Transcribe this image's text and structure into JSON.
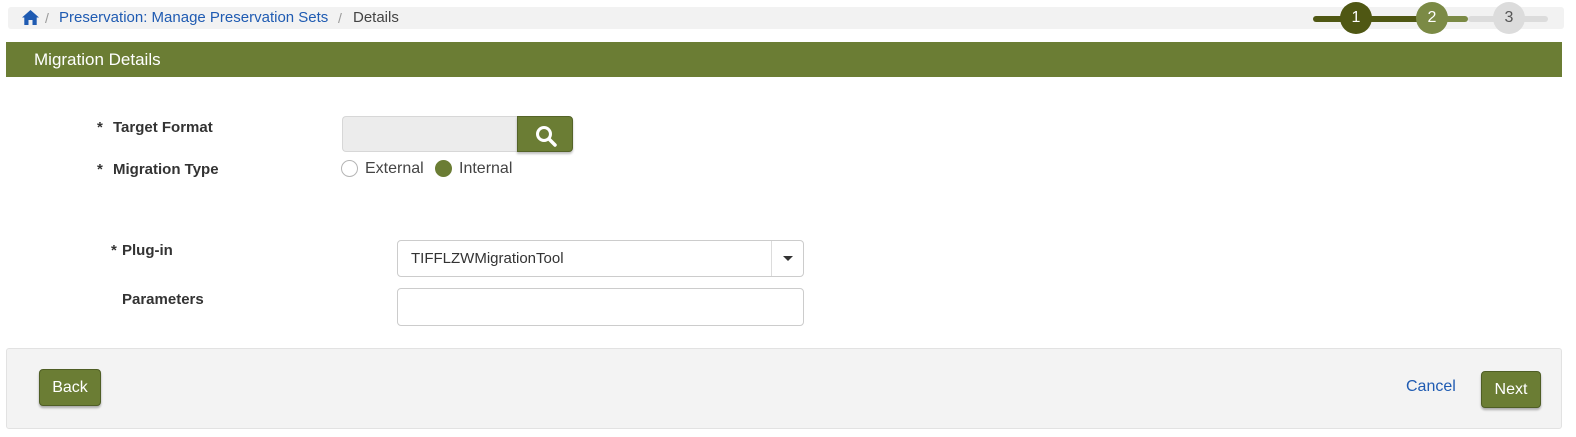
{
  "breadcrumb": {
    "home_icon": "home-icon",
    "separator": "/",
    "items": [
      {
        "label": "Preservation: Manage Preservation Sets"
      },
      {
        "label": "Details"
      }
    ]
  },
  "stepper": {
    "steps": [
      {
        "label": "1",
        "state": "current",
        "color": "#4f5713"
      },
      {
        "label": "2",
        "state": "next",
        "color": "#7b8a45"
      },
      {
        "label": "3",
        "state": "upcoming",
        "color": "#dcdcdc"
      }
    ]
  },
  "section": {
    "title": "Migration Details",
    "color": "#6b7d34"
  },
  "form": {
    "required_mark": "*",
    "target_format": {
      "label": "Target Format",
      "value": "",
      "button_icon": "search-icon"
    },
    "migration_type": {
      "label": "Migration Type",
      "options": [
        {
          "label": "External",
          "selected": false
        },
        {
          "label": "Internal",
          "selected": true
        }
      ]
    },
    "plugin": {
      "label": "Plug-in",
      "value": "TIFFLZWMigrationTool",
      "dropdown_icon": "chevron-down-icon"
    },
    "parameters": {
      "label": "Parameters",
      "value": ""
    }
  },
  "footer": {
    "back_label": "Back",
    "cancel_label": "Cancel",
    "next_label": "Next"
  }
}
